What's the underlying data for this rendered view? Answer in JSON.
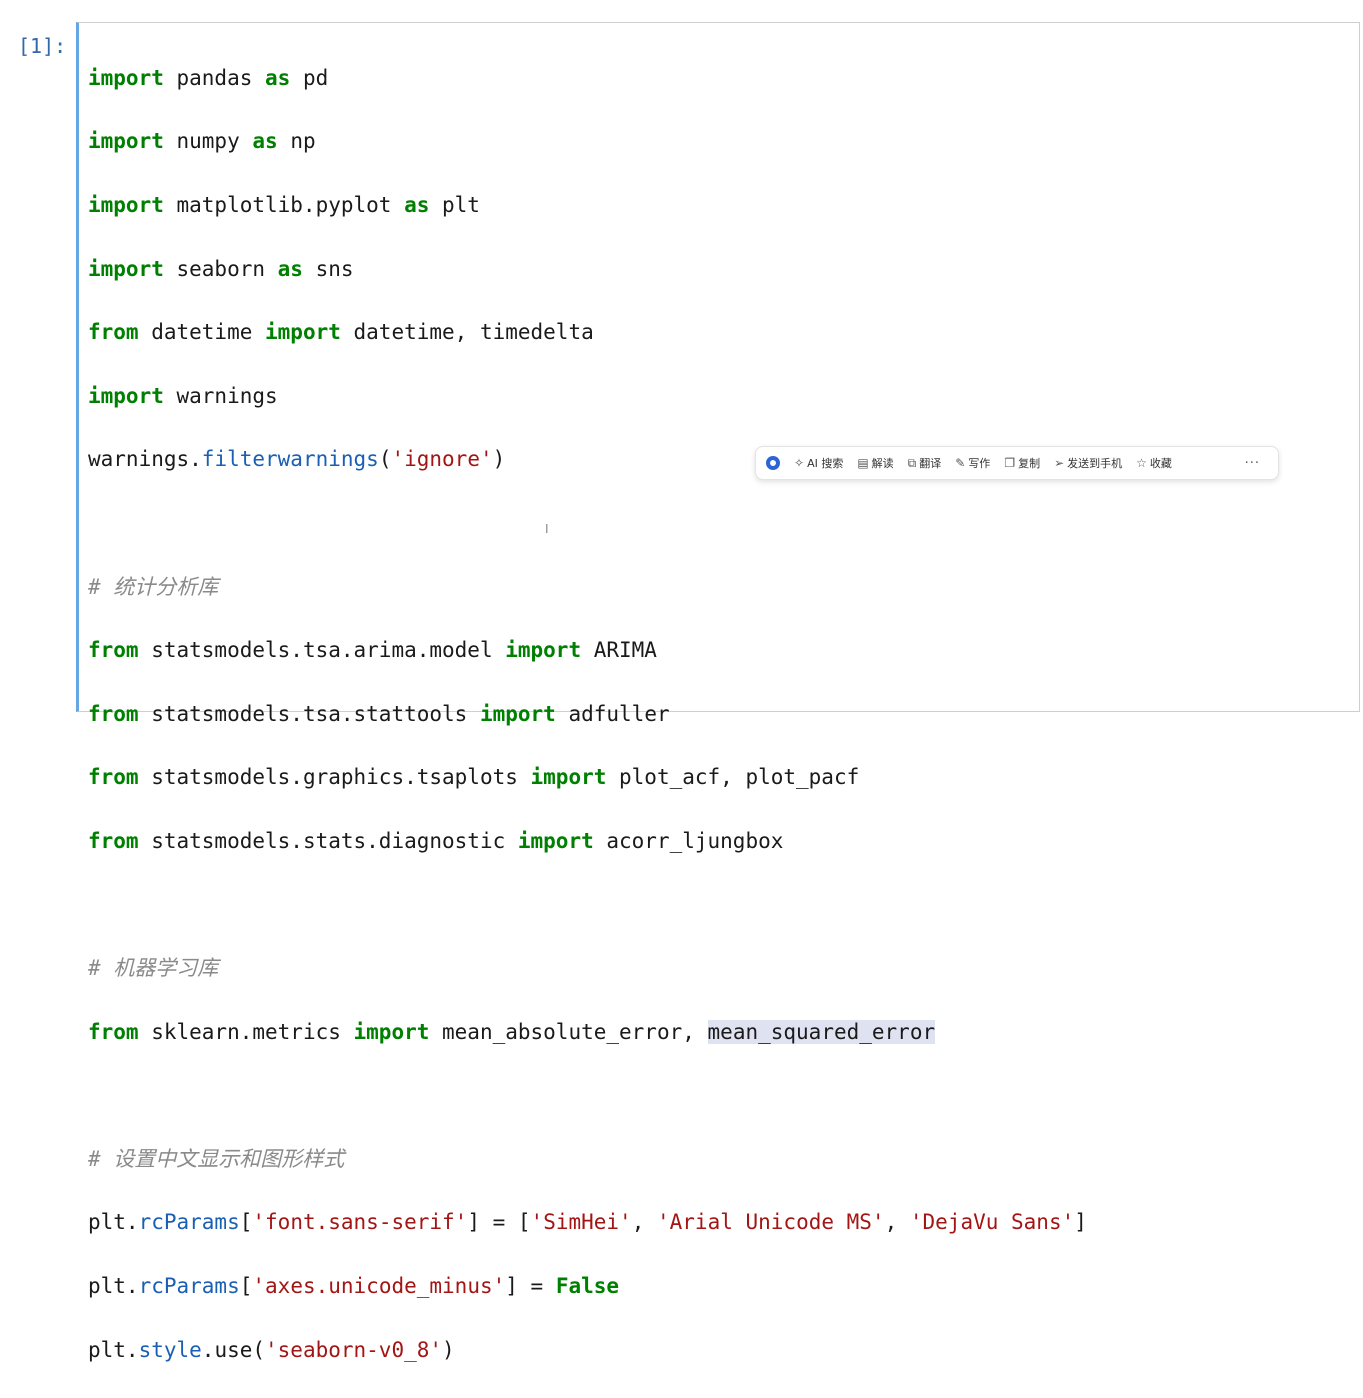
{
  "cell": {
    "prompt": "[1]:"
  },
  "code": {
    "l1": {
      "kw1": "import",
      "t1": " pandas ",
      "kw2": "as",
      "t2": " pd"
    },
    "l2": {
      "kw1": "import",
      "t1": " numpy ",
      "kw2": "as",
      "t2": " np"
    },
    "l3": {
      "kw1": "import",
      "t1": " matplotlib.pyplot ",
      "kw2": "as",
      "t2": " plt"
    },
    "l4": {
      "kw1": "import",
      "t1": " seaborn ",
      "kw2": "as",
      "t2": " sns"
    },
    "l5": {
      "kw1": "from",
      "t1": " datetime ",
      "kw2": "import",
      "t2": " datetime, timedelta"
    },
    "l6": {
      "kw1": "import",
      "t1": " warnings"
    },
    "l7": {
      "t1": "warnings.",
      "attr": "filterwarnings",
      "t2": "(",
      "str": "'ignore'",
      "t3": ")"
    },
    "c1": {
      "hash": "# ",
      "text": "统计分析库"
    },
    "l9": {
      "kw1": "from",
      "t1": " statsmodels.tsa.arima.model ",
      "kw2": "import",
      "t2": " ARIMA"
    },
    "l10": {
      "kw1": "from",
      "t1": " statsmodels.tsa.stattools ",
      "kw2": "import",
      "t2": " adfuller"
    },
    "l11": {
      "kw1": "from",
      "t1": " statsmodels.graphics.tsaplots ",
      "kw2": "import",
      "t2": " plot_acf, plot_pacf"
    },
    "l12": {
      "kw1": "from",
      "t1": " statsmodels.stats.diagnostic ",
      "kw2": "import",
      "t2": " acorr_ljungbox"
    },
    "c2": {
      "hash": "# ",
      "text": "机器学习库"
    },
    "l14": {
      "kw1": "from",
      "t1": " sklearn.metrics ",
      "kw2": "import",
      "t2": " mean_absolute_error, ",
      "hl": "mean_squared_error"
    },
    "c3": {
      "hash": "# ",
      "text": "设置中文显示和图形样式"
    },
    "l16": {
      "t1": "plt.",
      "attr": "rcParams",
      "t2": "[",
      "s1": "'font.sans-serif'",
      "t3": "] = [",
      "s2": "'SimHei'",
      "t4": ", ",
      "s3": "'Arial Unicode MS'",
      "t5": ", ",
      "s4": "'DejaVu Sans'",
      "t6": "]"
    },
    "l17": {
      "t1": "plt.",
      "attr": "rcParams",
      "t2": "[",
      "s1": "'axes.unicode_minus'",
      "t3": "] = ",
      "kw1": "False"
    },
    "l18": {
      "t1": "plt.",
      "attr": "style",
      "t2": ".use(",
      "s1": "'seaborn-v0_8'",
      "t3": ")"
    }
  },
  "toolbar": {
    "items": [
      {
        "icon": "sparkle-icon",
        "glyph": "✧",
        "label": "AI 搜索"
      },
      {
        "icon": "read-icon",
        "glyph": "▤",
        "label": "解读"
      },
      {
        "icon": "translate-icon",
        "glyph": "⧉",
        "label": "翻译"
      },
      {
        "icon": "pen-icon",
        "glyph": "✎",
        "label": "写作"
      },
      {
        "icon": "copy-icon",
        "glyph": "❐",
        "label": "复制"
      },
      {
        "icon": "send-icon",
        "glyph": "➢",
        "label": "发送到手机"
      },
      {
        "icon": "star-icon",
        "glyph": "☆",
        "label": "收藏"
      }
    ],
    "more": "···"
  }
}
